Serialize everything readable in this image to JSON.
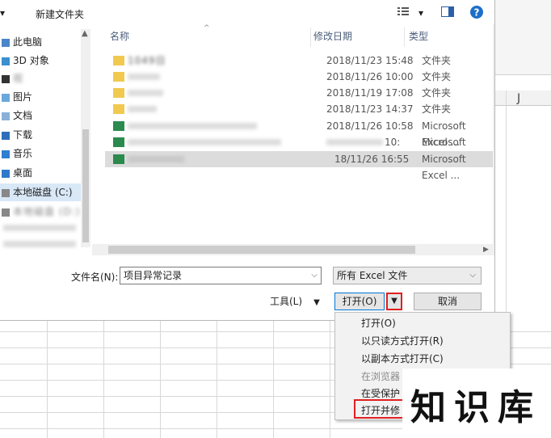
{
  "toolbar": {
    "new_folder_label": "新建文件夹",
    "view_icon": "view-list-icon",
    "help_icon": "help-icon"
  },
  "nav": {
    "items": [
      {
        "label": "此电脑",
        "icon": "computer-icon"
      },
      {
        "label": "3D 对象",
        "icon": "cube-icon"
      },
      {
        "label": "视",
        "icon": "video-icon"
      },
      {
        "label": "图片",
        "icon": "picture-icon"
      },
      {
        "label": "文档",
        "icon": "document-icon"
      },
      {
        "label": "下载",
        "icon": "download-icon"
      },
      {
        "label": "音乐",
        "icon": "music-icon"
      },
      {
        "label": "桌面",
        "icon": "desktop-icon"
      },
      {
        "label": "本地磁盘 (C:)",
        "icon": "drive-icon"
      },
      {
        "label": "本地磁盘 (D:)",
        "icon": "drive-icon"
      }
    ]
  },
  "list": {
    "headers": {
      "name": "名称",
      "date": "修改日期",
      "type": "类型"
    },
    "rows": [
      {
        "name": "1049日",
        "date": "2018/11/23 15:48",
        "type": "文件夹",
        "icon": "folder-icon"
      },
      {
        "name": "",
        "date": "2018/11/26 10:00",
        "type": "文件夹",
        "icon": "folder-icon"
      },
      {
        "name": "",
        "date": "2018/11/19 17:08",
        "type": "文件夹",
        "icon": "folder-icon"
      },
      {
        "name": "",
        "date": "2018/11/23 14:37",
        "type": "文件夹",
        "icon": "folder-icon"
      },
      {
        "name": "",
        "date": "2018/11/26 10:58",
        "type": "Microsoft Excel ...",
        "icon": "excel-icon"
      },
      {
        "name": "",
        "date": "10:",
        "type": "Microsoft Excel ...",
        "icon": "excel-icon"
      },
      {
        "name": "",
        "date": "18/11/26 16:55",
        "type": "Microsoft Excel ...",
        "icon": "excel-icon"
      }
    ]
  },
  "filename": {
    "label": "文件名(N):",
    "value": "项目异常记录"
  },
  "filetype": {
    "value": "所有 Excel 文件"
  },
  "buttons": {
    "tools": "工具(L)",
    "open": "打开(O)",
    "cancel": "取消"
  },
  "menu": {
    "items": [
      {
        "label": "打开(O)",
        "enabled": true
      },
      {
        "label": "以只读方式打开(R)",
        "enabled": true
      },
      {
        "label": "以副本方式打开(C)",
        "enabled": true
      },
      {
        "label": "在浏览器",
        "enabled": false
      },
      {
        "label": "在受保护",
        "enabled": true
      },
      {
        "label": "打开并修",
        "enabled": true
      }
    ]
  },
  "excel": {
    "column_label": "J"
  },
  "watermark": {
    "text": "知识库"
  },
  "colors": {
    "accent": "#0078d7",
    "highlight_red": "#e02020"
  }
}
